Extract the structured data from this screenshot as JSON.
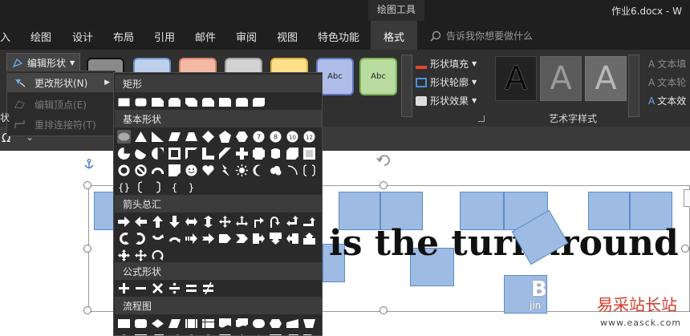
{
  "titlebar": {
    "context_group": "绘图工具",
    "doc_title": "作业6.docx - W"
  },
  "tabs": [
    {
      "label": "入"
    },
    {
      "label": "绘图"
    },
    {
      "label": "设计"
    },
    {
      "label": "布局"
    },
    {
      "label": "引用"
    },
    {
      "label": "邮件"
    },
    {
      "label": "审阅"
    },
    {
      "label": "视图"
    },
    {
      "label": "特色功能"
    },
    {
      "label": "格式",
      "active": true
    }
  ],
  "tell_me": {
    "placeholder": "告诉我你想要做什么"
  },
  "ribbon": {
    "edit_shape": "编辑形状",
    "shape_styles": [
      {
        "text": "",
        "fill": "#8a8a8a"
      },
      {
        "text": "",
        "fill": "#bcd0ec"
      },
      {
        "text": "",
        "fill": "#f4b9a5"
      },
      {
        "text": "",
        "fill": "#d2d2d2"
      },
      {
        "text": "",
        "fill": "#ffe08a"
      },
      {
        "text": "Abc",
        "fill": "#aebde9"
      },
      {
        "text": "Abc",
        "fill": "#b8dca0"
      }
    ],
    "shape_fill": "形状填充",
    "shape_outline": "形状轮廓",
    "shape_effects": "形状效果",
    "wordart_label": "艺术字样式",
    "wordart_letter": "A",
    "text_fill": "文本填",
    "text_outline": "文本轮",
    "text_effects": "文本效"
  },
  "edit_menu": {
    "change_shape": "更改形状(N)",
    "edit_points": "编辑顶点(E)",
    "reroute": "重排连接符(T)",
    "side_label": "状"
  },
  "gallery": {
    "categories": {
      "rect": "矩形",
      "basic": "基本形状",
      "arrows": "箭头总汇",
      "equation": "公式形状",
      "flowchart": "流程图"
    }
  },
  "strip": {
    "omega": "Ω",
    "arrow": "⌄"
  },
  "document": {
    "text": "is the turnaround tim",
    "watermark": "易采站长站",
    "watermark_url": "www.easck.com",
    "side_glyph": "B",
    "side_small": "jin"
  },
  "colors": {
    "accent_blue": "#5b8cc7",
    "rect_fill": "#9dbbe3",
    "watermark_red": "#d23a2a"
  }
}
